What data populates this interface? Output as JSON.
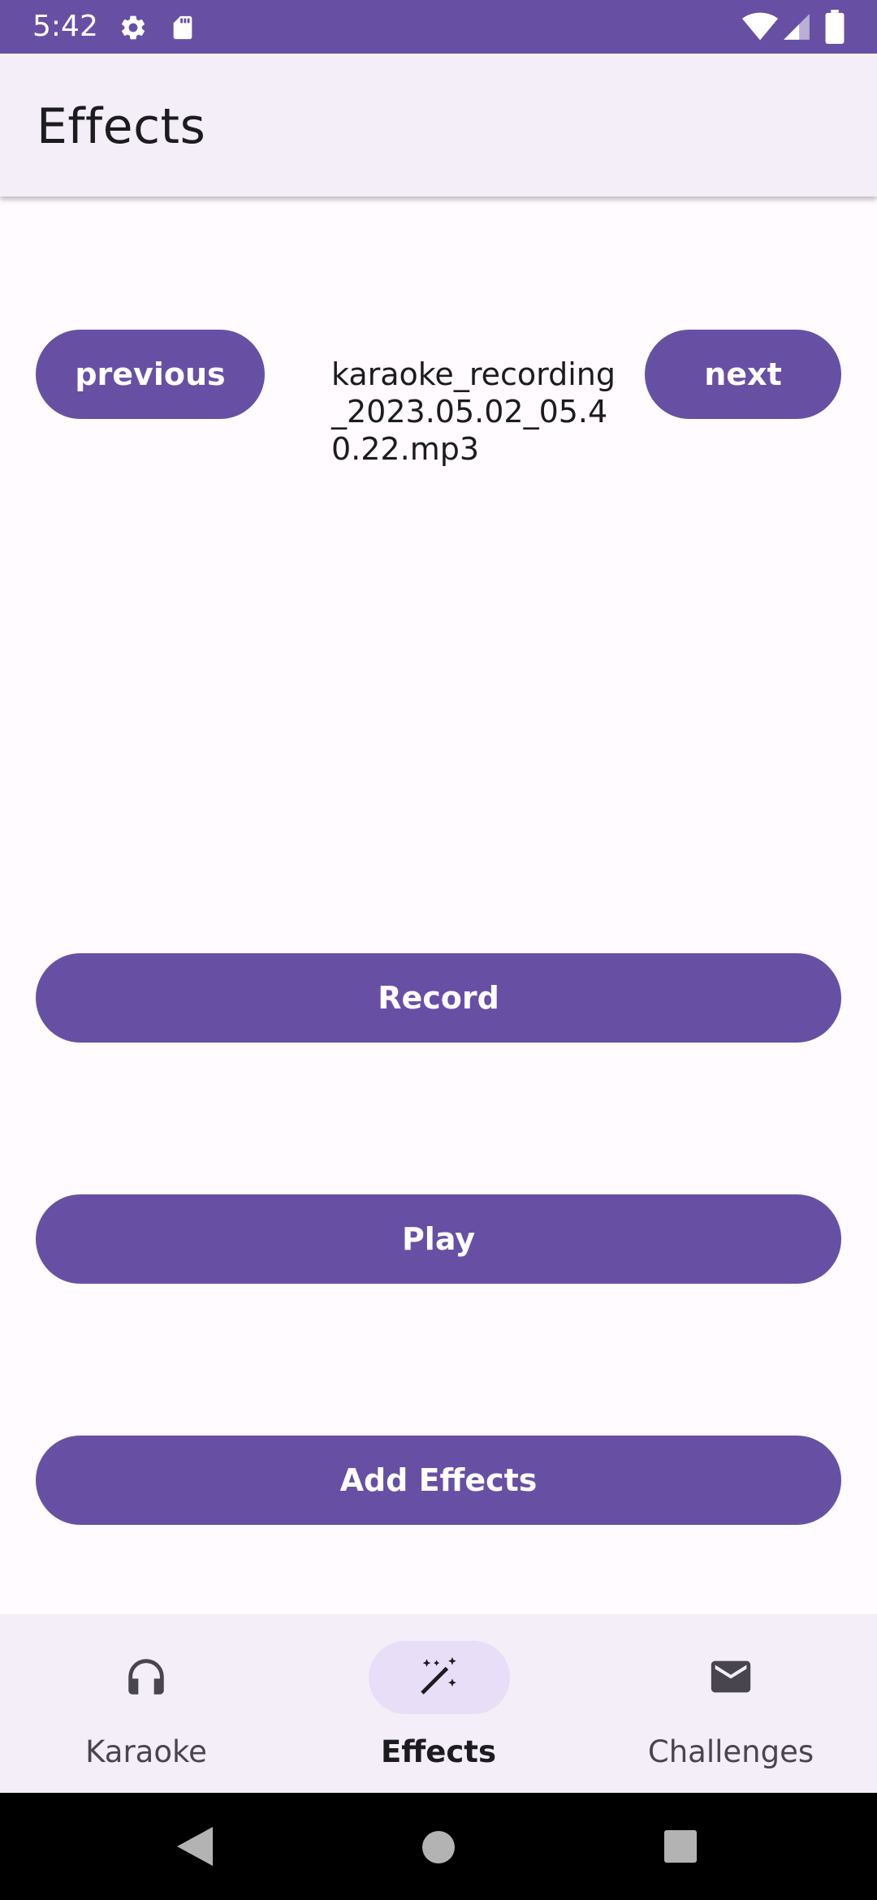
{
  "status_bar": {
    "time": "5:42",
    "icons": [
      "gear-icon",
      "sd-card-icon",
      "wifi-icon",
      "signal-icon",
      "battery-icon"
    ]
  },
  "app_bar": {
    "title": "Effects"
  },
  "player": {
    "previous_label": "previous",
    "next_label": "next",
    "file_name": "karaoke_recording_2023.05.02_05.40.22.mp3"
  },
  "actions": {
    "record_label": "Record",
    "play_label": "Play",
    "add_effects_label": "Add Effects"
  },
  "bottom_nav": {
    "items": [
      {
        "label": "Karaoke",
        "icon": "headphones-icon",
        "active": false
      },
      {
        "label": "Effects",
        "icon": "magic-wand-icon",
        "active": true
      },
      {
        "label": "Challenges",
        "icon": "mail-icon",
        "active": false
      }
    ]
  },
  "system_nav": {
    "buttons": [
      "back-icon",
      "home-icon",
      "recents-icon"
    ]
  },
  "colors": {
    "primary": "#6750a4",
    "surface": "#fffbff",
    "surface_container": "#f3eef7",
    "indicator": "#e8def8"
  }
}
